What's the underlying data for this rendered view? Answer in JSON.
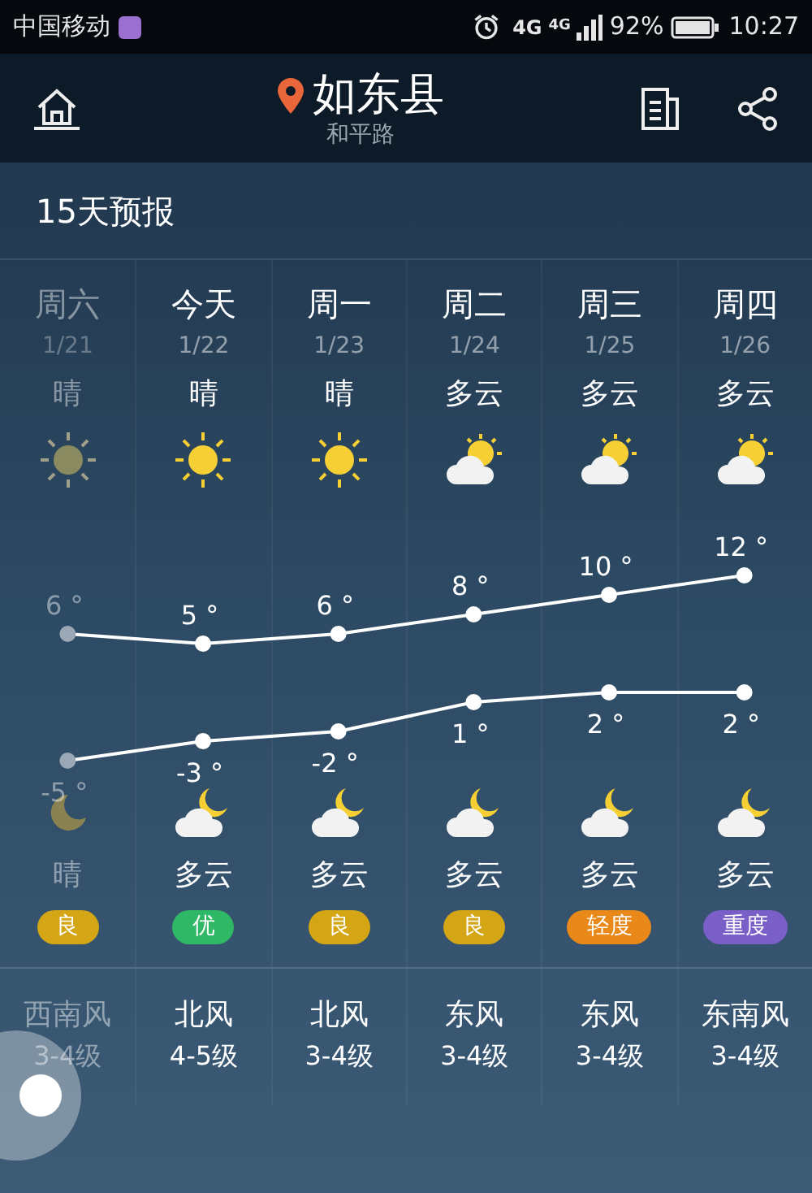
{
  "status_bar": {
    "carrier": "中国移动",
    "network_1": "4G",
    "network_2": "4G",
    "battery": "92%",
    "time": "10:27"
  },
  "header": {
    "city": "如东县",
    "district": "和平路"
  },
  "section_title": "15天预报",
  "days": [
    {
      "day": "周六",
      "date": "1/21",
      "past": true,
      "day_weather": "晴",
      "day_icon": {
        "kind": "sun"
      },
      "high": "6 °",
      "low": "-5 °",
      "night_icon": {
        "kind": "moon"
      },
      "night_weather": "晴",
      "aqi": {
        "label": "良",
        "color": "#d4a514"
      },
      "wind": "西南风",
      "wind_level": "3-4级"
    },
    {
      "day": "今天",
      "date": "1/22",
      "past": false,
      "day_weather": "晴",
      "day_icon": {
        "kind": "sun"
      },
      "high": "5 °",
      "low": "-3 °",
      "night_icon": {
        "kind": "cloud_moon"
      },
      "night_weather": "多云",
      "aqi": {
        "label": "优",
        "color": "#2fb865"
      },
      "wind": "北风",
      "wind_level": "4-5级"
    },
    {
      "day": "周一",
      "date": "1/23",
      "past": false,
      "day_weather": "晴",
      "day_icon": {
        "kind": "sun"
      },
      "high": "6 °",
      "low": "-2 °",
      "night_icon": {
        "kind": "cloud_moon"
      },
      "night_weather": "多云",
      "aqi": {
        "label": "良",
        "color": "#d4a514"
      },
      "wind": "北风",
      "wind_level": "3-4级"
    },
    {
      "day": "周二",
      "date": "1/24",
      "past": false,
      "day_weather": "多云",
      "day_icon": {
        "kind": "cloud_sun"
      },
      "high": "8 °",
      "low": "1 °",
      "night_icon": {
        "kind": "cloud_moon"
      },
      "night_weather": "多云",
      "aqi": {
        "label": "良",
        "color": "#d4a514"
      },
      "wind": "东风",
      "wind_level": "3-4级"
    },
    {
      "day": "周三",
      "date": "1/25",
      "past": false,
      "day_weather": "多云",
      "day_icon": {
        "kind": "cloud_sun"
      },
      "high": "10 °",
      "low": "2 °",
      "night_icon": {
        "kind": "cloud_moon"
      },
      "night_weather": "多云",
      "aqi": {
        "label": "轻度",
        "color": "#e8891a"
      },
      "wind": "东风",
      "wind_level": "3-4级"
    },
    {
      "day": "周四",
      "date": "1/26",
      "past": false,
      "day_weather": "多云",
      "day_icon": {
        "kind": "cloud_sun"
      },
      "high": "12 °",
      "low": "2 °",
      "night_icon": {
        "kind": "cloud_moon"
      },
      "night_weather": "多云",
      "aqi": {
        "label": "重度",
        "color": "#7b5fc8"
      },
      "wind": "东南风",
      "wind_level": "3-4级"
    }
  ]
}
